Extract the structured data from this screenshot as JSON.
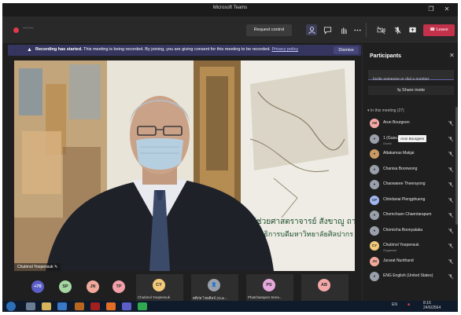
{
  "window": {
    "title": "Microsoft Teams"
  },
  "toolbar": {
    "timer": "—:—",
    "request_control": "Request control",
    "leave": "Leave",
    "icons": [
      "participants-icon",
      "chat-icon",
      "raise-hand-icon",
      "more-icon",
      "camera-off-icon",
      "mic-icon",
      "share-icon",
      "phone-icon"
    ]
  },
  "banner": {
    "bold": "Recording has started.",
    "message": "This meeting is being recorded. By joining, you are giving consent for this meeting to be recorded.",
    "link": "Privacy policy",
    "dismiss": "Dismiss"
  },
  "video": {
    "speaker_name": "Chutimol Yoopensuk",
    "background_caption_line1": "ผู้ช่วยศาสตราจารย์ สังขาญู ถาวรเวช",
    "background_caption_line2": "อธิการบดีมหาวิทยาลัยศิลปากร"
  },
  "strip": {
    "avatars": [
      {
        "initials": "+70",
        "color": "#5b5fc7"
      },
      {
        "initials": "SP",
        "color": "#a6d6a2"
      },
      {
        "initials": "JN",
        "color": "#f2a99c"
      },
      {
        "initials": "TP",
        "color": "#f4a0a8"
      }
    ],
    "tiles": [
      {
        "initials": "CY",
        "name": "Chutimol Yoopensuk",
        "color": "#f3c97a"
      },
      {
        "initials": "",
        "name": "ศศิภัส ไชยศิลป์ (Gue...",
        "color": "#9aa0aa"
      },
      {
        "initials": "PS",
        "name": "Phatcharapon Sena...",
        "color": "#e7a8dc"
      },
      {
        "initials": "AB",
        "name": "",
        "color": "#f4a8a8"
      }
    ]
  },
  "panel": {
    "title": "Participants",
    "invite_placeholder": "Invite someone or dial a number",
    "share_invite": "Share invite",
    "section": "In this meeting (27)",
    "tooltip": "Arun Bourgeen",
    "participants": [
      {
        "initials": "AB",
        "name": "Arun Bourgeen",
        "sub": "",
        "color": "#f4a8a8"
      },
      {
        "initials": "",
        "name": "1 (Gues...",
        "sub": "Guest",
        "color": "#9aa0aa"
      },
      {
        "initials": "",
        "name": "Attakamas Makjai",
        "sub": "",
        "color": "#c99b62"
      },
      {
        "initials": "",
        "name": "Chanisa Boonwong",
        "sub": "",
        "color": "#9aa0aa"
      },
      {
        "initials": "",
        "name": "Chaowaree Theerayong",
        "sub": "",
        "color": "#9aa0aa"
      },
      {
        "initials": "CP",
        "name": "Chindanai Plengphueng",
        "sub": "",
        "color": "#9fb6f0"
      },
      {
        "initials": "",
        "name": "Chomchuen Channtarapum",
        "sub": "",
        "color": "#9aa0aa"
      },
      {
        "initials": "",
        "name": "Chomicha Boonyalaka",
        "sub": "",
        "color": "#9aa0aa"
      },
      {
        "initials": "CY",
        "name": "Chutimol Yoopensuk",
        "sub": "Organizer",
        "color": "#f3c97a"
      },
      {
        "initials": "JN",
        "name": "Jurarat Nunthand",
        "sub": "",
        "color": "#f2a99c"
      },
      {
        "initials": "",
        "name": "ENG English (United States)",
        "sub": "",
        "color": "#9aa0aa"
      }
    ]
  },
  "taskbar": {
    "lang": "EN",
    "time": "8:16",
    "date": "24/6/2564"
  }
}
